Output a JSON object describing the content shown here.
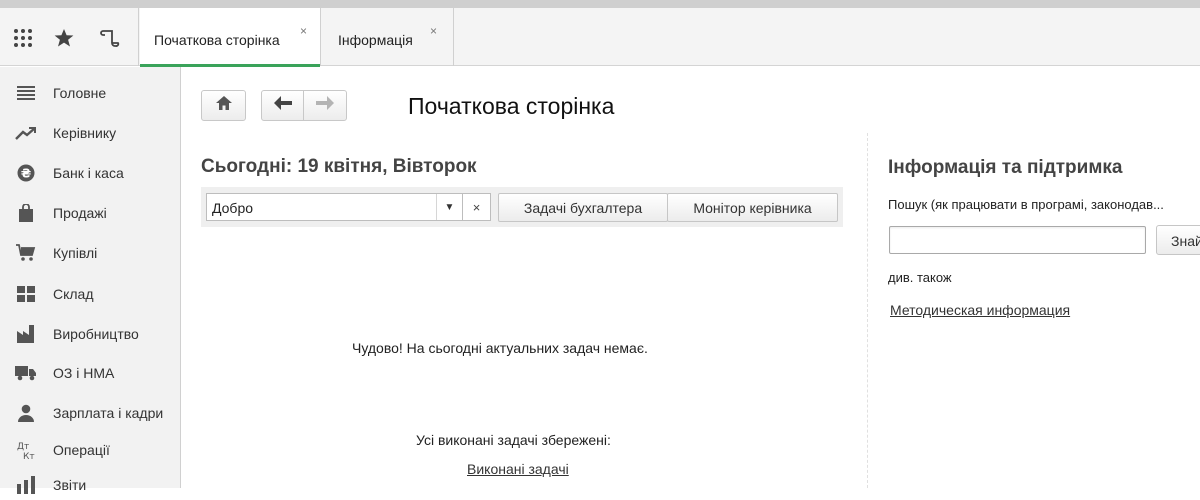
{
  "topbar": {
    "icons": [
      "apps-grid-icon",
      "star-icon",
      "history-icon"
    ],
    "tabs": [
      {
        "label": "Початкова сторінка",
        "close": "×",
        "active": true
      },
      {
        "label": "Інформація",
        "close": "×",
        "active": false
      }
    ]
  },
  "sidebar": {
    "items": [
      {
        "label": "Головне",
        "icon": "menu-lines-icon"
      },
      {
        "label": "Керівнику",
        "icon": "trend-up-icon"
      },
      {
        "label": "Банк і каса",
        "icon": "currency-coin-icon"
      },
      {
        "label": "Продажі",
        "icon": "shopping-bag-icon"
      },
      {
        "label": "Купівлі",
        "icon": "cart-icon"
      },
      {
        "label": "Склад",
        "icon": "warehouse-grid-icon"
      },
      {
        "label": "Виробництво",
        "icon": "factory-icon"
      },
      {
        "label": "ОЗ і НМА",
        "icon": "truck-icon"
      },
      {
        "label": "Зарплата і кадри",
        "icon": "person-icon"
      },
      {
        "label": "Операції",
        "icon": "dt-kt-icon"
      },
      {
        "label": "Звіти",
        "icon": "bar-chart-icon"
      }
    ]
  },
  "main": {
    "page_title": "Початкова сторінка",
    "today": "Сьогодні: 19 квітня, Вівторок",
    "combo_value": "Добро",
    "clear_label": "×",
    "buttons": {
      "accountant_tasks": "Задачі бухгалтера",
      "manager_monitor": "Монітор керівника"
    },
    "no_tasks_message": "Чудово! На сьогодні актуальних задач немає.",
    "saved_message": "Усі виконані задачі збережені:",
    "completed_link": "Виконані задачі"
  },
  "info_panel": {
    "title": "Інформація та підтримка",
    "search_label": "Пошук (як працювати в програмі, законодав...",
    "search_value": "",
    "find_button": "Знайти",
    "see_also": "див. також",
    "methodical_link": "Методическая информация"
  },
  "colors": {
    "active_tab_accent": "#3aa35a",
    "sidebar_bg": "#f2f2f2"
  }
}
